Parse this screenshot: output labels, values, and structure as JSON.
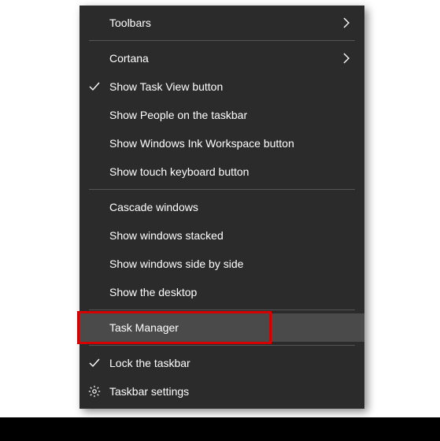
{
  "menu": {
    "groups": [
      [
        {
          "label": "Toolbars",
          "submenu": true,
          "checked": false,
          "icon": null
        },
        {
          "label": "Cortana",
          "submenu": true,
          "checked": false,
          "icon": null
        },
        {
          "label": "Show Task View button",
          "submenu": false,
          "checked": true,
          "icon": null
        },
        {
          "label": "Show People on the taskbar",
          "submenu": false,
          "checked": false,
          "icon": null
        },
        {
          "label": "Show Windows Ink Workspace button",
          "submenu": false,
          "checked": false,
          "icon": null
        },
        {
          "label": "Show touch keyboard button",
          "submenu": false,
          "checked": false,
          "icon": null
        }
      ],
      [
        {
          "label": "Cascade windows",
          "submenu": false,
          "checked": false,
          "icon": null
        },
        {
          "label": "Show windows stacked",
          "submenu": false,
          "checked": false,
          "icon": null
        },
        {
          "label": "Show windows side by side",
          "submenu": false,
          "checked": false,
          "icon": null
        },
        {
          "label": "Show the desktop",
          "submenu": false,
          "checked": false,
          "icon": null
        }
      ],
      [
        {
          "label": "Task Manager",
          "submenu": false,
          "checked": false,
          "icon": null,
          "hovered": true,
          "highlighted": true
        }
      ],
      [
        {
          "label": "Lock the taskbar",
          "submenu": false,
          "checked": true,
          "icon": null
        },
        {
          "label": "Taskbar settings",
          "submenu": false,
          "checked": false,
          "icon": "gear"
        }
      ]
    ]
  },
  "colors": {
    "menu_bg": "#2b2b2b",
    "hover_bg": "#4a4a4a",
    "highlight_border": "#d20000"
  }
}
